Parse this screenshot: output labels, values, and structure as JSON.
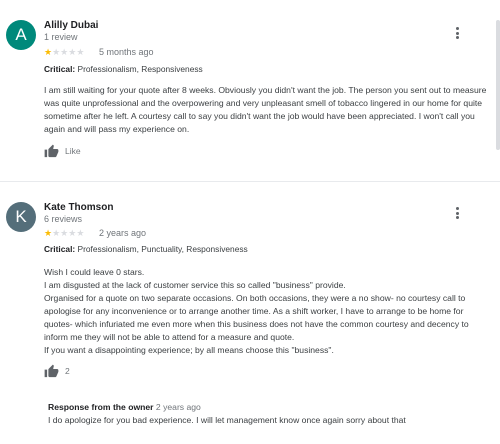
{
  "colors": {
    "star_on": "#fbbc04",
    "star_off": "#dadce0",
    "avatar_1": "#00897b",
    "avatar_2": "#546e7a"
  },
  "reviews": [
    {
      "avatar_letter": "A",
      "name": "Alilly Dubai",
      "count": "1 review",
      "rating": 1,
      "date": "5 months ago",
      "critical_label": "Critical:",
      "critical_value": "Professionalism, Responsiveness",
      "text": "I am still waiting for your quote after 8 weeks. Obviously you didn't want the job. The person you sent out to measure was quite unprofessional and the overpowering and very unpleasant smell of tobacco lingered in our home for quite sometime after he left. A courtesy call to say you didn't want the job would have been appreciated. I won't call you again and will pass my experience on.",
      "like_label": "Like",
      "menu_icon": "more-vert-icon",
      "like_icon": "thumb-up-icon"
    },
    {
      "avatar_letter": "K",
      "name": "Kate Thomson",
      "count": "6 reviews",
      "rating": 1,
      "date": "2 years ago",
      "critical_label": "Critical:",
      "critical_value": "Professionalism, Punctuality, Responsiveness",
      "text_lines": [
        "Wish I could leave 0 stars.",
        "I am disgusted at the lack of customer service this so called \"business\" provide.",
        "Organised for a quote on two separate occasions. On both occasions, they were a no show- no courtesy call to apologise for any inconvenience or to arrange another time. As a shift worker, I have to arrange to be home for quotes- which infuriated me even more when this business does not have the common courtesy and decency to inform me they will not be able to attend for a measure and quote.",
        "If you want a disappointing experience; by all means choose this \"business\"."
      ],
      "like_count": "2",
      "owner_response_title": "Response from the owner",
      "owner_response_date": "2 years ago",
      "owner_response_text": "I do apologize for you bad experience. I will let management know once again sorry about that",
      "menu_icon": "more-vert-icon",
      "like_icon": "thumb-up-icon"
    }
  ]
}
